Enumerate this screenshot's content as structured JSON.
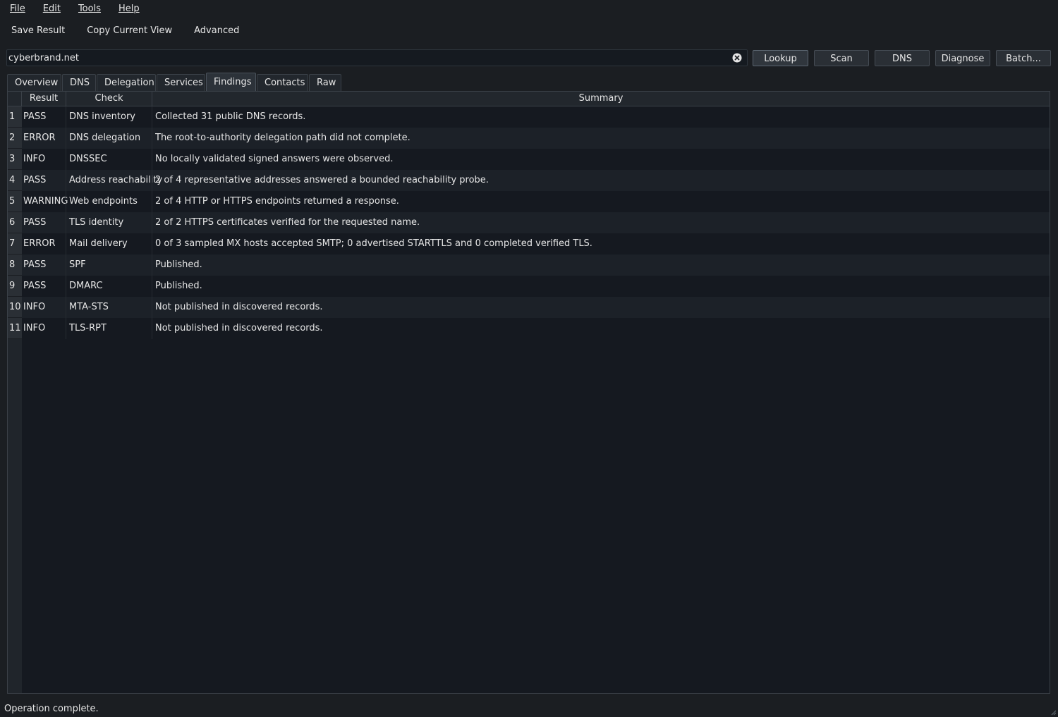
{
  "menu": {
    "file": "File",
    "edit": "Edit",
    "tools": "Tools",
    "help": "Help"
  },
  "toolbar": {
    "save_result": "Save Result",
    "copy_current_view": "Copy Current View",
    "advanced": "Advanced"
  },
  "search": {
    "value": "cyberbrand.net",
    "clear_icon": "clear-circle-x"
  },
  "actions": {
    "lookup": "Lookup",
    "scan": "Scan",
    "dns": "DNS",
    "diagnose": "Diagnose",
    "batch": "Batch..."
  },
  "tabs": {
    "overview": "Overview",
    "dns": "DNS",
    "delegation": "Delegation",
    "services": "Services",
    "findings": "Findings",
    "contacts": "Contacts",
    "raw": "Raw",
    "active": "Findings"
  },
  "table": {
    "columns": {
      "result": "Result",
      "check": "Check",
      "summary": "Summary"
    },
    "rows": [
      {
        "num": "1",
        "result": "PASS",
        "check": "DNS inventory",
        "summary": "Collected 31 public DNS records."
      },
      {
        "num": "2",
        "result": "ERROR",
        "check": "DNS delegation",
        "summary": "The root-to-authority delegation path did not complete."
      },
      {
        "num": "3",
        "result": "INFO",
        "check": "DNSSEC",
        "summary": "No locally validated signed answers were observed."
      },
      {
        "num": "4",
        "result": "PASS",
        "check": "Address reachability",
        "summary": "2 of 4 representative addresses answered a bounded reachability probe."
      },
      {
        "num": "5",
        "result": "WARNING",
        "check": "Web endpoints",
        "summary": "2 of 4 HTTP or HTTPS endpoints returned a response."
      },
      {
        "num": "6",
        "result": "PASS",
        "check": "TLS identity",
        "summary": "2 of 2 HTTPS certificates verified for the requested name."
      },
      {
        "num": "7",
        "result": "ERROR",
        "check": "Mail delivery",
        "summary": "0 of 3 sampled MX hosts accepted SMTP; 0 advertised STARTTLS and 0 completed verified TLS."
      },
      {
        "num": "8",
        "result": "PASS",
        "check": "SPF",
        "summary": "Published."
      },
      {
        "num": "9",
        "result": "PASS",
        "check": "DMARC",
        "summary": "Published."
      },
      {
        "num": "10",
        "result": "INFO",
        "check": "MTA-STS",
        "summary": "Not published in discovered records."
      },
      {
        "num": "11",
        "result": "INFO",
        "check": "TLS-RPT",
        "summary": "Not published in discovered records."
      }
    ]
  },
  "status": {
    "text": "Operation complete."
  }
}
